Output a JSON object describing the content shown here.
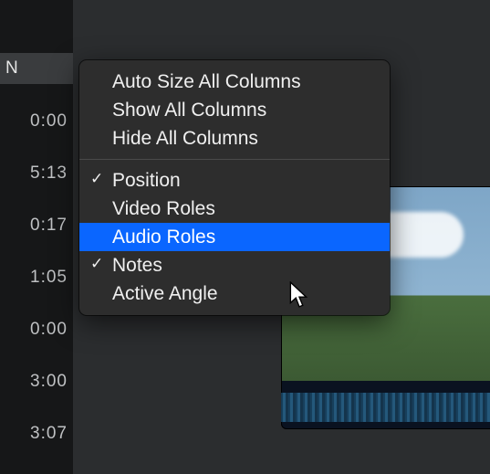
{
  "time_column": {
    "partial_tab_text": "N",
    "times": [
      "0:00",
      "5:13",
      "0:17",
      "1:05",
      "0:00",
      "3:00",
      "3:07"
    ]
  },
  "context_menu": {
    "section1": [
      {
        "label": "Auto Size All Columns",
        "checked": false,
        "highlight": false
      },
      {
        "label": "Show All Columns",
        "checked": false,
        "highlight": false
      },
      {
        "label": "Hide All Columns",
        "checked": false,
        "highlight": false
      }
    ],
    "section2": [
      {
        "label": "Position",
        "checked": true,
        "highlight": false
      },
      {
        "label": "Video Roles",
        "checked": false,
        "highlight": false
      },
      {
        "label": "Audio Roles",
        "checked": false,
        "highlight": true
      },
      {
        "label": "Notes",
        "checked": true,
        "highlight": false
      },
      {
        "label": "Active Angle",
        "checked": false,
        "highlight": false
      }
    ]
  }
}
